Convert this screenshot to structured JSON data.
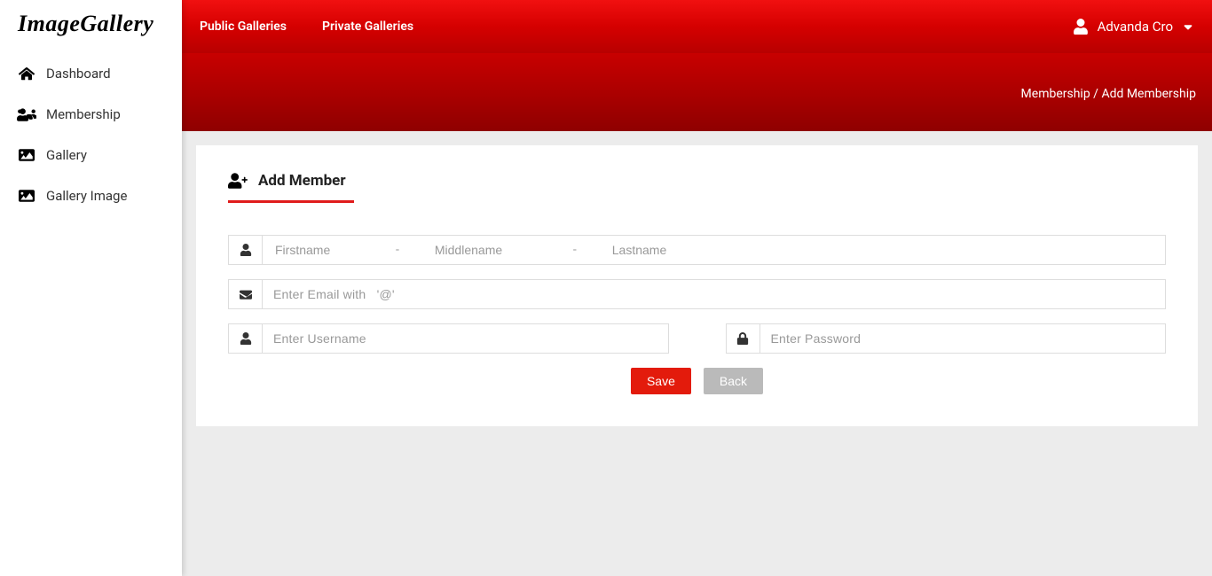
{
  "brand": "ImageGallery",
  "sidebar": {
    "items": [
      {
        "label": "Dashboard"
      },
      {
        "label": "Membership"
      },
      {
        "label": "Gallery"
      },
      {
        "label": "Gallery Image"
      }
    ]
  },
  "topbar": {
    "links": [
      {
        "label": "Public Galleries"
      },
      {
        "label": "Private Galleries"
      }
    ],
    "user_name": "Advanda Cro"
  },
  "breadcrumb": {
    "parent": "Membership",
    "sep": " / ",
    "current": "Add Membership"
  },
  "panel": {
    "title": "Add Member"
  },
  "form": {
    "firstname_ph": "Firstname",
    "middlename_ph": "Middlename",
    "lastname_ph": "Lastname",
    "dash": "-",
    "email_ph": "Enter Email with   '@'",
    "username_ph": "Enter Username",
    "password_ph": "Enter Password",
    "save_label": "Save",
    "back_label": "Back"
  },
  "colors": {
    "primary_red": "#d50000",
    "accent_red": "#e31b0c"
  }
}
